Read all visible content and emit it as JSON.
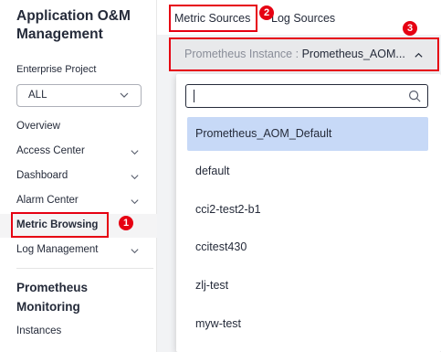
{
  "sidebar": {
    "app_title": "Application O&M Management",
    "enterprise_project_label": "Enterprise Project",
    "enterprise_project_value": "ALL",
    "items": [
      {
        "label": "Overview",
        "expandable": false
      },
      {
        "label": "Access Center",
        "expandable": true
      },
      {
        "label": "Dashboard",
        "expandable": true
      },
      {
        "label": "Alarm Center",
        "expandable": true
      },
      {
        "label": "Metric Browsing",
        "expandable": false,
        "active": true
      },
      {
        "label": "Log Management",
        "expandable": true
      }
    ],
    "prometheus_title": "Prometheus Monitoring",
    "instances_label": "Instances"
  },
  "tabs": [
    {
      "label": "Metric Sources",
      "active": true
    },
    {
      "label": "Log Sources",
      "active": false
    }
  ],
  "instance_select": {
    "prefix": "Prometheus Instance :",
    "value": "Prometheus_AOM..."
  },
  "dropdown": {
    "search_value": "",
    "options": [
      {
        "label": "Prometheus_AOM_Default",
        "selected": true
      },
      {
        "label": "default"
      },
      {
        "label": "cci2-test2-b1"
      },
      {
        "label": "ccitest430"
      },
      {
        "label": "zlj-test"
      },
      {
        "label": "myw-test"
      }
    ]
  },
  "annotations": {
    "badge_1": "1",
    "badge_2": "2",
    "badge_3": "3",
    "color": "#e60012"
  },
  "colors": {
    "selected_option_bg": "#c7d9f7",
    "main_bg": "#f2f3f5",
    "active_nav_bg": "#f4f4f5"
  }
}
